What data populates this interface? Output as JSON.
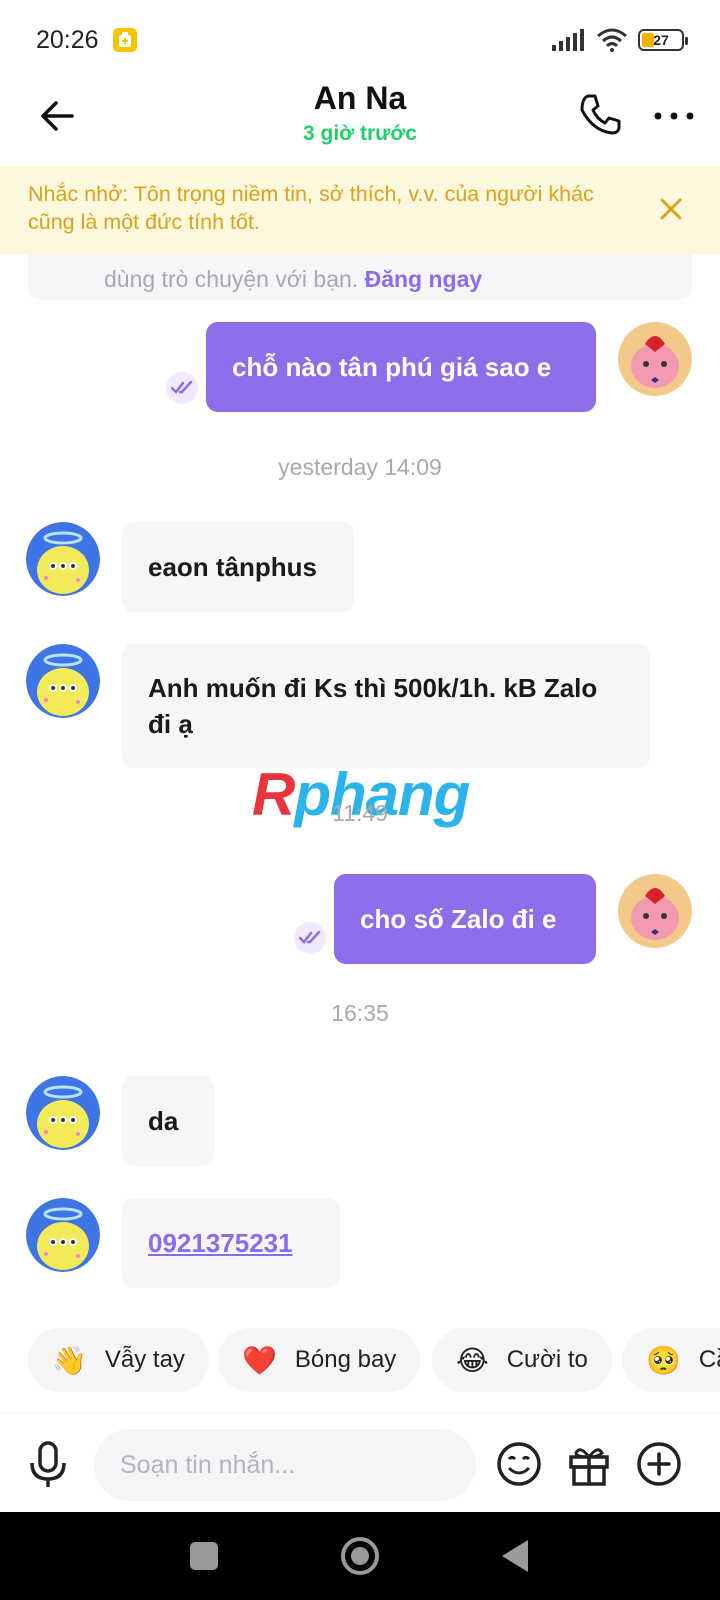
{
  "status_bar": {
    "time": "20:26",
    "battery": "27"
  },
  "header": {
    "contact_name": "An Na",
    "last_seen": "3 giờ trước"
  },
  "reminder": {
    "text": "Nhắc nhở: Tôn trọng niềm tin, sở thích, v.v. của người khác cũng là một đức tính tốt."
  },
  "system_card": {
    "text": "dùng trò chuyện với bạn.",
    "link": "Đăng ngay"
  },
  "messages": [
    {
      "type": "out",
      "text": "chỗ nào tân phú giá sao e"
    },
    {
      "type": "timestamp",
      "text": "yesterday 14:09"
    },
    {
      "type": "in",
      "text": "eaon tânphus"
    },
    {
      "type": "in",
      "text": "Anh muốn đi Ks thì 500k/1h. kB Zalo đi ạ"
    },
    {
      "type": "timestamp",
      "text": "11:49"
    },
    {
      "type": "out",
      "text": "cho số Zalo đi e"
    },
    {
      "type": "timestamp",
      "text": "16:35"
    },
    {
      "type": "in",
      "text": "da"
    },
    {
      "type": "in",
      "text": "0921375231"
    }
  ],
  "watermark": {
    "first": "R",
    "rest": "phang"
  },
  "quick_replies": [
    {
      "emoji": "👋",
      "label": "Vẫy tay"
    },
    {
      "emoji": "❤️",
      "label": "Bóng bay"
    },
    {
      "emoji": "😂",
      "label": "Cười to"
    },
    {
      "emoji": "🥺",
      "label": "Cầ"
    }
  ],
  "composer": {
    "placeholder": "Soạn tin nhắn..."
  },
  "colors": {
    "accent": "#8f6cea",
    "online": "#1fcf6a",
    "reminder_text": "#d9a31a",
    "reminder_bg": "#fdf7dd"
  }
}
